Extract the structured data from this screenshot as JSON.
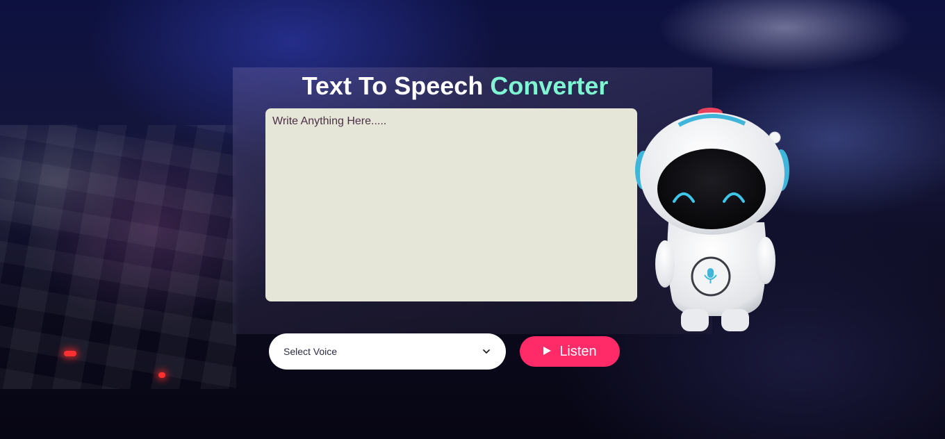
{
  "header": {
    "title_main": "Text To Speech",
    "title_accent": "Converter"
  },
  "editor": {
    "placeholder": "Write Anything Here.....",
    "value": ""
  },
  "voice_select": {
    "selected": "Select Voice",
    "icon": "chevron-down-icon"
  },
  "listen_button": {
    "label": "Listen",
    "icon": "play-icon"
  },
  "colors": {
    "accent": "#7ff5d1",
    "button": "#ff2a68",
    "textarea_bg": "#e6e6d8"
  }
}
